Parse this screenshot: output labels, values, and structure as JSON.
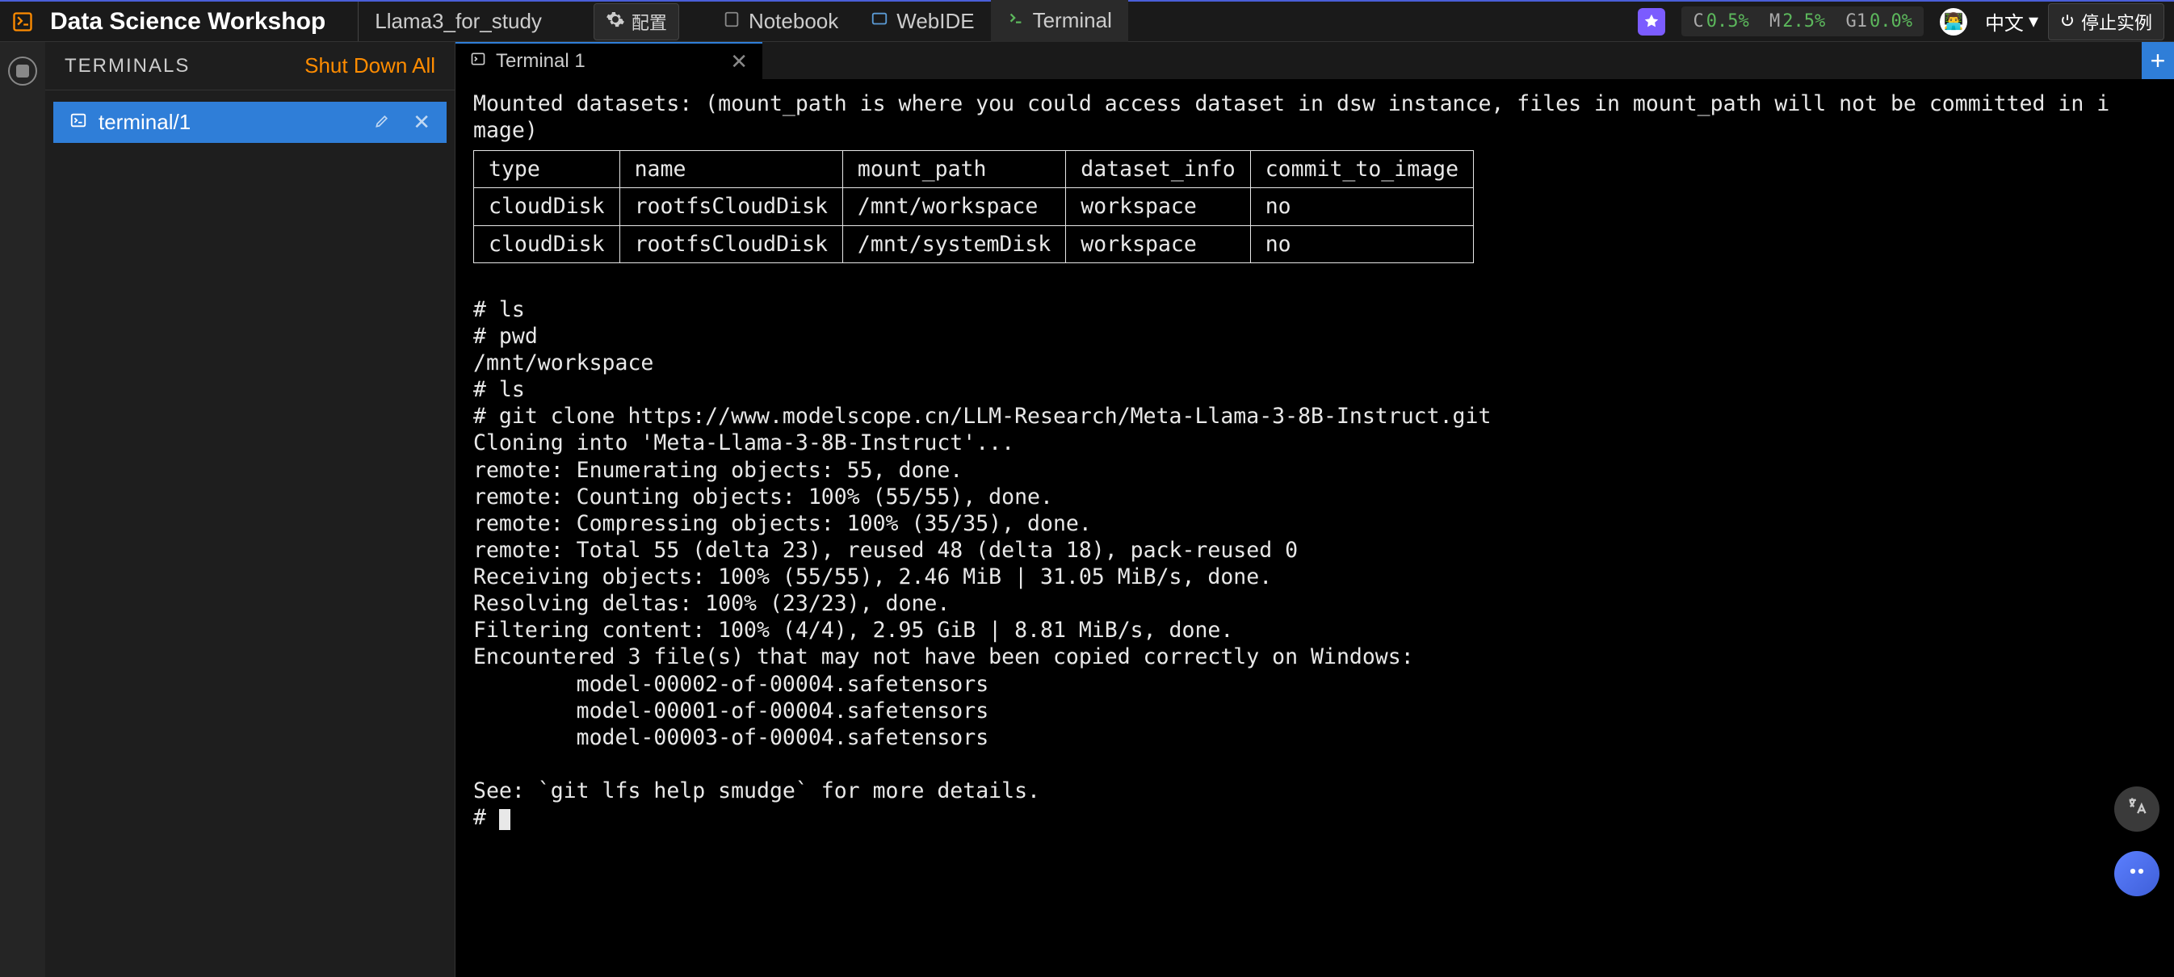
{
  "header": {
    "app_title": "Data Science Workshop",
    "instance_name": "Llama3_for_study",
    "config_label": "配置",
    "tabs": {
      "notebook": "Notebook",
      "webide": "WebIDE",
      "terminal": "Terminal"
    },
    "stats": {
      "c_label": "C",
      "c_val": "0.5%",
      "m_label": "M",
      "m_val": "2.5%",
      "g_label": "G1",
      "g_val": "0.0%"
    },
    "language": "中文",
    "stop_label": "停止实例"
  },
  "sidebar": {
    "title": "TERMINALS",
    "shutdown": "Shut Down All",
    "items": [
      {
        "label": "terminal/1"
      }
    ]
  },
  "editor": {
    "tab_label": "Terminal 1",
    "add_label": "+"
  },
  "terminal": {
    "pre1": "Mounted datasets: (mount_path is where you could access dataset in dsw instance, files in mount_path will not be committed in i\nmage)",
    "table": {
      "headers": [
        "type",
        "name",
        "mount_path",
        "dataset_info",
        "commit_to_image"
      ],
      "rows": [
        [
          "cloudDisk",
          "rootfsCloudDisk",
          "/mnt/workspace",
          "workspace",
          "no"
        ],
        [
          "cloudDisk",
          "rootfsCloudDisk",
          "/mnt/systemDisk",
          "workspace",
          "no"
        ]
      ]
    },
    "post": "\n# ls\n# pwd\n/mnt/workspace\n# ls\n# git clone https://www.modelscope.cn/LLM-Research/Meta-Llama-3-8B-Instruct.git\nCloning into 'Meta-Llama-3-8B-Instruct'...\nremote: Enumerating objects: 55, done.\nremote: Counting objects: 100% (55/55), done.\nremote: Compressing objects: 100% (35/35), done.\nremote: Total 55 (delta 23), reused 48 (delta 18), pack-reused 0\nReceiving objects: 100% (55/55), 2.46 MiB | 31.05 MiB/s, done.\nResolving deltas: 100% (23/23), done.\nFiltering content: 100% (4/4), 2.95 GiB | 8.81 MiB/s, done.\nEncountered 3 file(s) that may not have been copied correctly on Windows:\n        model-00002-of-00004.safetensors\n        model-00001-of-00004.safetensors\n        model-00003-of-00004.safetensors\n\nSee: `git lfs help smudge` for more details.\n# "
  }
}
